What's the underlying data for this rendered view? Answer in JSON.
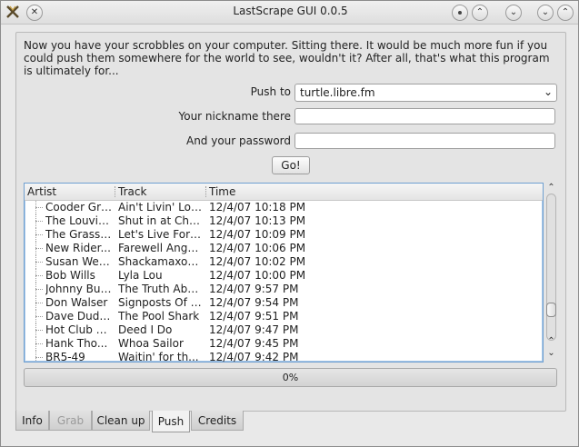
{
  "window": {
    "title": "LastScrape GUI 0.0.5"
  },
  "intro_text": "Now you have your scrobbles on your computer. Sitting there. It would be much more fun if you could push them somewhere for the world to see, wouldn't it? After all, that's what this program is ultimately for...",
  "form": {
    "push_to_label": "Push to",
    "push_to_value": "turtle.libre.fm",
    "nickname_label": "Your nickname there",
    "nickname_value": "",
    "password_label": "And your password",
    "password_value": "",
    "go_label": "Go!"
  },
  "table": {
    "columns": [
      "Artist",
      "Track",
      "Time"
    ],
    "rows": [
      {
        "artist": "Cooder Graw",
        "track": "Ain't Livin' Lon...",
        "time": "12/4/07 10:18 PM"
      },
      {
        "artist": "The Louvin...",
        "track": "Shut in at Chri...",
        "time": "12/4/07 10:13 PM"
      },
      {
        "artist": "The Grass ...",
        "track": "Let's Live For ...",
        "time": "12/4/07 10:09 PM"
      },
      {
        "artist": "New Rider...",
        "track": "Farewell Angel...",
        "time": "12/4/07 10:06 PM"
      },
      {
        "artist": "Susan Wer...",
        "track": "Shackamaxon ...",
        "time": "12/4/07 10:02 PM"
      },
      {
        "artist": "Bob Wills",
        "track": "Lyla Lou",
        "time": "12/4/07 10:00 PM"
      },
      {
        "artist": "Johnny Bush",
        "track": "The Truth Abo...",
        "time": "12/4/07 9:57 PM"
      },
      {
        "artist": "Don Walser",
        "track": "Signposts Of L...",
        "time": "12/4/07 9:54 PM"
      },
      {
        "artist": "Dave Dudley",
        "track": "The Pool Shark",
        "time": "12/4/07 9:51 PM"
      },
      {
        "artist": "Hot Club o...",
        "track": "Deed I Do",
        "time": "12/4/07 9:47 PM"
      },
      {
        "artist": "Hank Tho...",
        "track": "Whoa Sailor",
        "time": "12/4/07 9:45 PM"
      },
      {
        "artist": "BR5-49",
        "track": "Waitin' for th...",
        "time": "12/4/07 9:42 PM"
      }
    ]
  },
  "progress": {
    "value": 0,
    "text": "0%"
  },
  "tabs": [
    {
      "label": "Info",
      "state": "normal"
    },
    {
      "label": "Grab",
      "state": "disabled"
    },
    {
      "label": "Clean up",
      "state": "normal"
    },
    {
      "label": "Push",
      "state": "active"
    },
    {
      "label": "Credits",
      "state": "normal"
    }
  ],
  "icons": {
    "app": "x-logo-icon",
    "close": "close-icon",
    "minimize": "minimize-icon",
    "maximize": "maximize-icon",
    "shade": "shade-icon",
    "keep_above": "keep-above-icon"
  },
  "colors": {
    "selection_border": "#6f9fd0",
    "progress_fill": "#6b9bd0"
  }
}
